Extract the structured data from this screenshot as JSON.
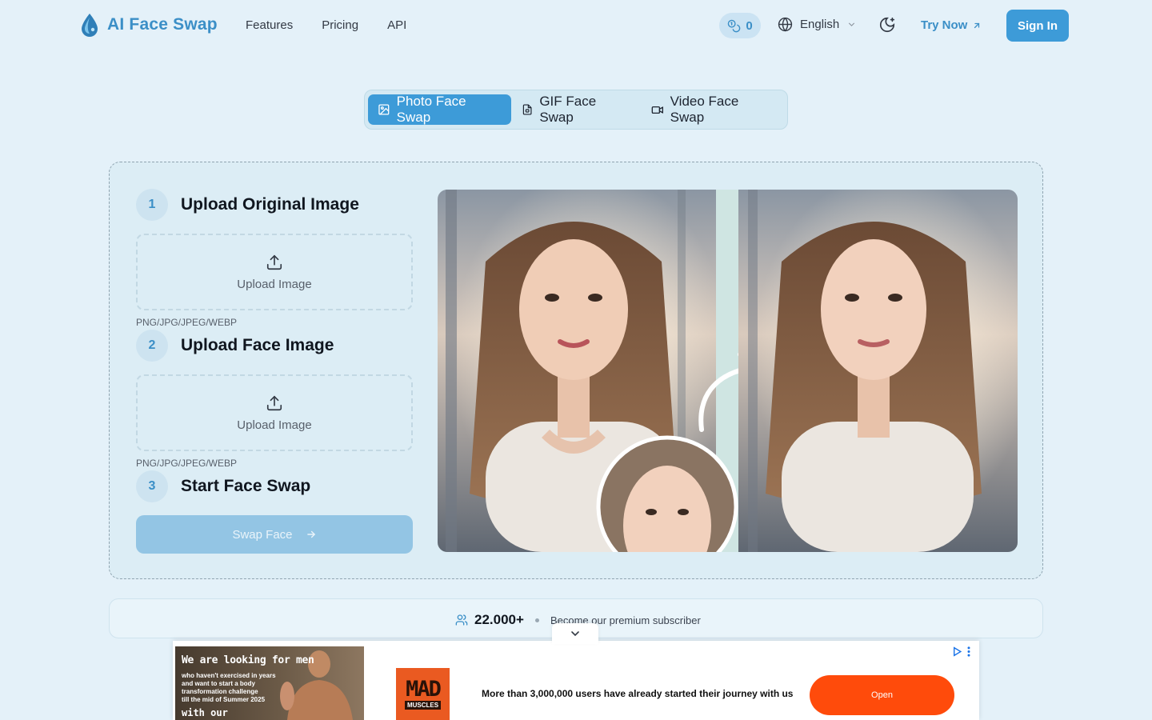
{
  "header": {
    "logo_text": "AI Face Swap",
    "nav": [
      "Features",
      "Pricing",
      "API"
    ],
    "credits": "0",
    "language": "English",
    "try_now": "Try Now",
    "sign_in": "Sign In"
  },
  "tabs": [
    "Photo Face Swap",
    "GIF Face Swap",
    "Video Face Swap"
  ],
  "active_tab": 0,
  "steps": [
    {
      "num": "1",
      "title": "Upload Original Image",
      "upload": "Upload Image",
      "formats": "PNG/JPG/JPEG/WEBP"
    },
    {
      "num": "2",
      "title": "Upload Face Image",
      "upload": "Upload Image",
      "formats": "PNG/JPG/JPEG/WEBP"
    },
    {
      "num": "3",
      "title": "Start Face Swap"
    }
  ],
  "swap_button": "Swap Face",
  "subscribers": {
    "count": "22.000+",
    "text": "Become our premium subscriber"
  },
  "ad": {
    "headline": "We are looking for men",
    "lines": [
      "who haven't exercised in years",
      "and want to start a body",
      "transformation challenge",
      "till the mid of Summer 2025"
    ],
    "with": "with our",
    "logo_main": "MAD",
    "logo_sub": "MUSCLES",
    "copy": "More than 3,000,000 users have already started their journey with us",
    "open": "Open"
  },
  "colors": {
    "brand": "#3b8fc7",
    "primary_button": "#3d9bd8",
    "background": "#e4f1f9",
    "ad_cta": "#ff4b0b"
  }
}
